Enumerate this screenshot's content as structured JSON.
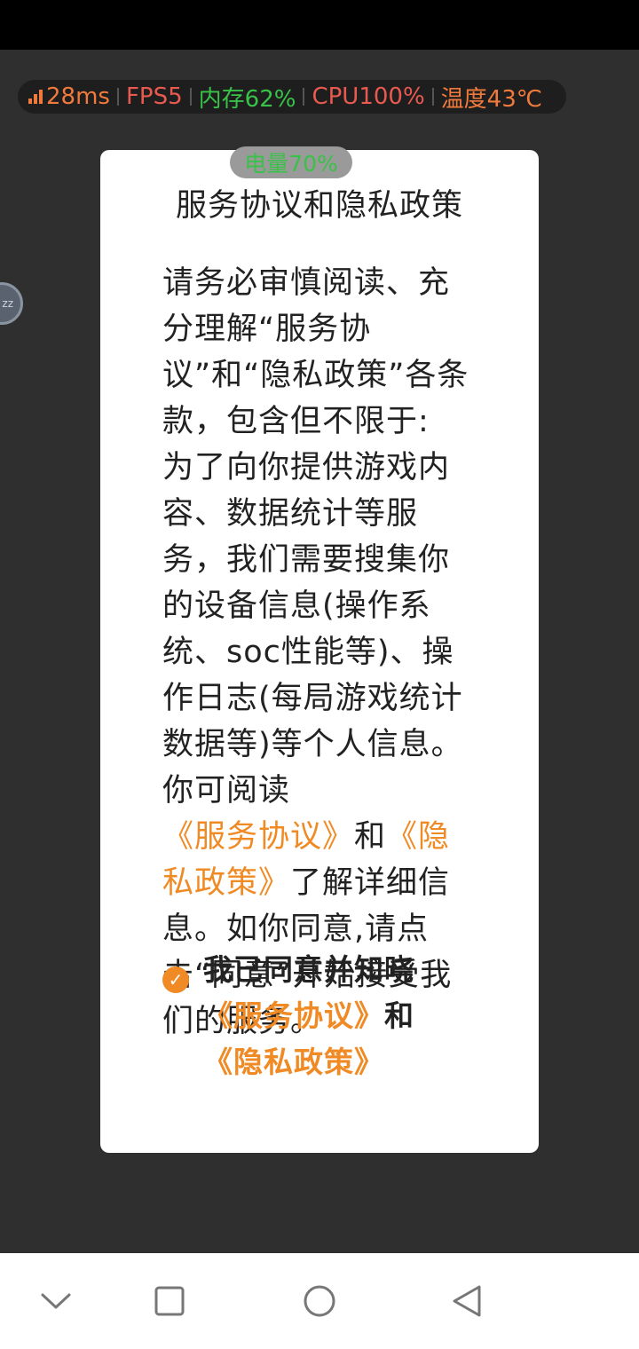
{
  "perf": {
    "ping": "28ms",
    "fps": "FPS5",
    "memory": "内存62%",
    "cpu": "CPU100%",
    "temp": "温度43℃"
  },
  "battery": "电量70%",
  "float_ball_text": "zz",
  "dialog": {
    "title": "服务协议和隐私政策",
    "body_1": "请务必审慎阅读、充分理解“服务协议”和“隐私政策”各条款，包含但不限于:",
    "body_2": "为了向你提供游戏内容、数据统计等服务，我们需要搜集你的设备信息(操作系统、soc性能等)、操作日志(每局游戏统计数据等)等个人信息。你可阅读",
    "link_service": "《服务协议》",
    "and": "和",
    "link_privacy": "《隐私政策》",
    "body_3": "了解详细信息。如你同意,请点击“同意”开始接受我们的服务。",
    "agree_prefix": "我已同意并知晓",
    "agree_link_service": "《服务协议》",
    "agree_and": "和",
    "agree_link_privacy": "《隐私政策》",
    "checkbox_checked": true
  },
  "colors": {
    "accent": "#f08a24",
    "perf_orange": "#f07a3b",
    "perf_red": "#e85a4f",
    "perf_green": "#39c248"
  },
  "navbar": {
    "icons": [
      "chevron-down-icon",
      "square-recent-icon",
      "circle-home-icon",
      "triangle-back-icon"
    ]
  }
}
